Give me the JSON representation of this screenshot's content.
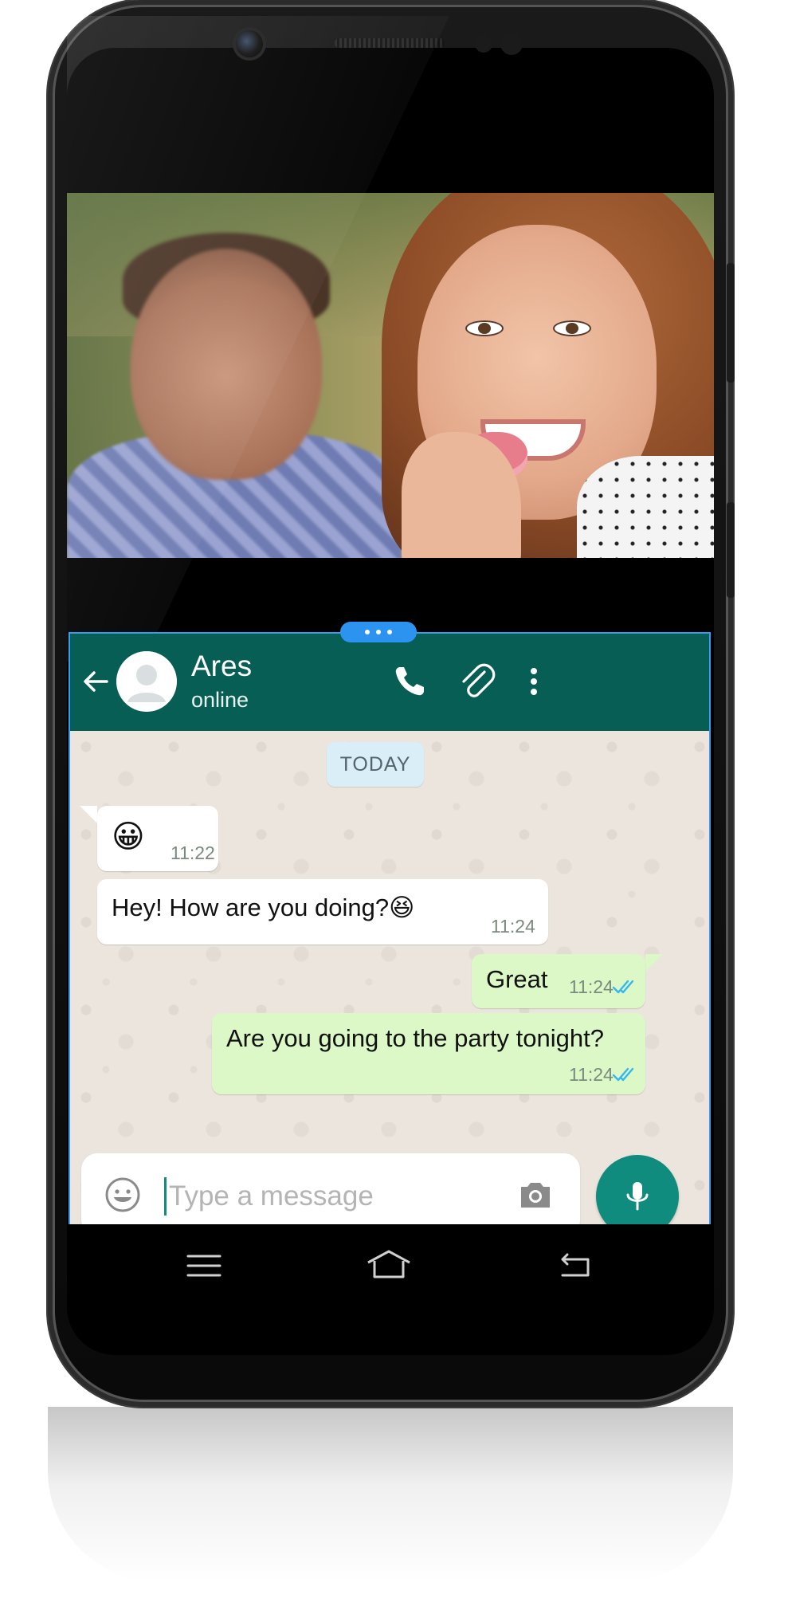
{
  "chat": {
    "contact_name": "Ares",
    "contact_status": "online",
    "date_label": "TODAY",
    "messages": [
      {
        "direction": "in",
        "text": "😀",
        "time": "11:22"
      },
      {
        "direction": "in",
        "text": "Hey! How are you doing?😆",
        "time": "11:24"
      },
      {
        "direction": "out",
        "text": "Great",
        "time": "11:24",
        "status": "read"
      },
      {
        "direction": "out",
        "text": "Are you going to the party tonight?",
        "time": "11:24",
        "status": "read"
      }
    ],
    "input_placeholder": "Type a message"
  },
  "icons": {
    "back": "arrow-left-icon",
    "call": "phone-icon",
    "attach": "paperclip-icon",
    "menu": "more-vertical-icon",
    "emoji": "emoji-icon",
    "camera": "camera-icon",
    "mic": "microphone-icon",
    "nav_menu": "menu-icon",
    "nav_home": "home-icon",
    "nav_back": "back-icon"
  },
  "colors": {
    "header": "#075e54",
    "chat_background": "#ece5dd",
    "incoming_bubble": "#ffffff",
    "outgoing_bubble": "#dcf8c6",
    "accent": "#0f8c7d",
    "read_ticks": "#34b7f1",
    "split_handle": "#2c93f0"
  }
}
